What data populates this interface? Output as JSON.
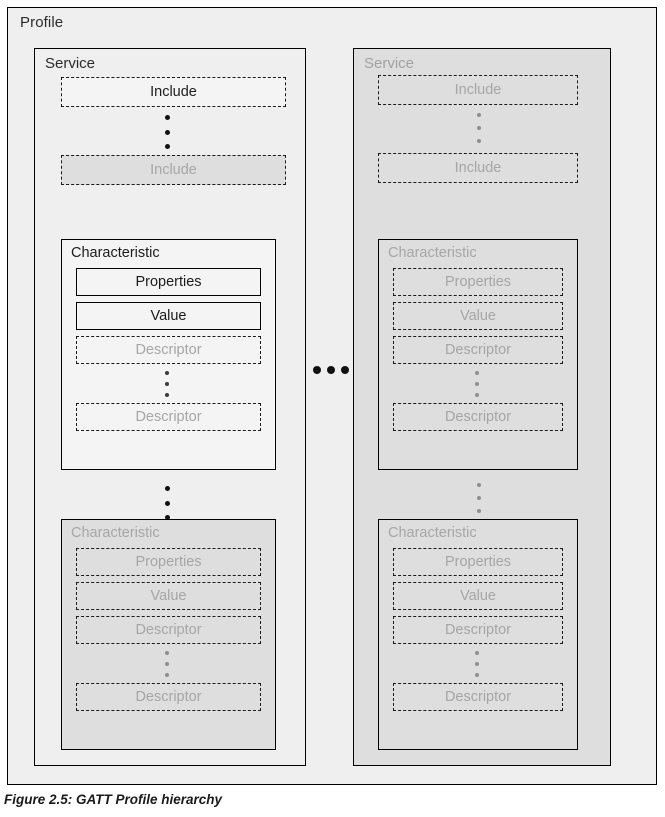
{
  "figure": {
    "caption": "Figure 2.5: GATT Profile hierarchy",
    "profile_label": "Profile"
  },
  "colors": {
    "page_background": "#ffffff",
    "profile_background": "#efefef",
    "service_active_background": "#efefef",
    "service_greyed_background": "#dedede",
    "node_active_background": "#f4f4f4",
    "node_greyed_background": "#dedede",
    "text_active": "#1c1c1c",
    "text_greyed": "#a6a6a6",
    "border": "#000000"
  },
  "services": [
    {
      "id": "service-left",
      "label": "Service",
      "state": "active",
      "includes": [
        {
          "label": "Include",
          "state": "active"
        },
        {
          "label": "Include",
          "state": "greyed"
        }
      ],
      "ellipsis_after_first_include": "vertical-dots",
      "characteristics": [
        {
          "label": "Characteristic",
          "state": "active",
          "properties": {
            "label": "Properties",
            "state": "active"
          },
          "value": {
            "label": "Value",
            "state": "active"
          },
          "descriptors": [
            {
              "label": "Descriptor",
              "state": "greyed"
            },
            {
              "label": "Descriptor",
              "state": "greyed"
            }
          ]
        },
        {
          "label": "Characteristic",
          "state": "greyed",
          "properties": {
            "label": "Properties",
            "state": "greyed"
          },
          "value": {
            "label": "Value",
            "state": "greyed"
          },
          "descriptors": [
            {
              "label": "Descriptor",
              "state": "greyed"
            },
            {
              "label": "Descriptor",
              "state": "greyed"
            }
          ]
        }
      ]
    },
    {
      "id": "service-right",
      "label": "Service",
      "state": "greyed",
      "includes": [
        {
          "label": "Include",
          "state": "greyed"
        },
        {
          "label": "Include",
          "state": "greyed"
        }
      ],
      "ellipsis_after_first_include": "vertical-dots",
      "characteristics": [
        {
          "label": "Characteristic",
          "state": "greyed",
          "properties": {
            "label": "Properties",
            "state": "greyed"
          },
          "value": {
            "label": "Value",
            "state": "greyed"
          },
          "descriptors": [
            {
              "label": "Descriptor",
              "state": "greyed"
            },
            {
              "label": "Descriptor",
              "state": "greyed"
            }
          ]
        },
        {
          "label": "Characteristic",
          "state": "greyed",
          "properties": {
            "label": "Properties",
            "state": "greyed"
          },
          "value": {
            "label": "Value",
            "state": "greyed"
          },
          "descriptors": [
            {
              "label": "Descriptor",
              "state": "greyed"
            },
            {
              "label": "Descriptor",
              "state": "greyed"
            }
          ]
        }
      ]
    }
  ],
  "separators": {
    "between_services": "...",
    "repeat_marker": "vertical-ellipsis"
  }
}
